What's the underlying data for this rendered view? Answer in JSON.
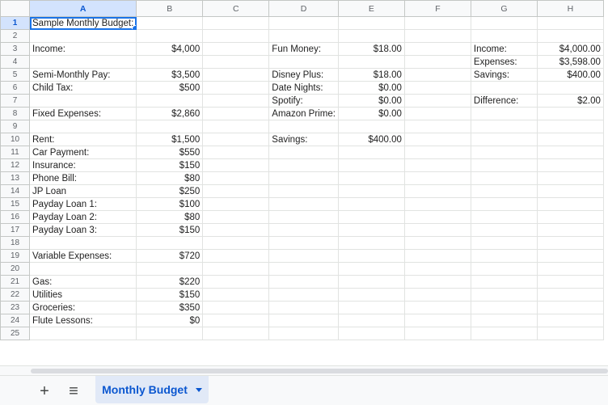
{
  "columns": [
    "A",
    "B",
    "C",
    "D",
    "E",
    "F",
    "G",
    "H"
  ],
  "active_cell": "A1",
  "rows": [
    {
      "n": "1",
      "a": "Sample Monthly Budget:",
      "b": "",
      "d": "",
      "e": "",
      "g": "",
      "h": ""
    },
    {
      "n": "2",
      "a": "",
      "b": "",
      "d": "",
      "e": "",
      "g": "",
      "h": ""
    },
    {
      "n": "3",
      "a": "Income:",
      "b": "$4,000",
      "d": "Fun Money:",
      "e": "$18.00",
      "g": "Income:",
      "h": "$4,000.00"
    },
    {
      "n": "4",
      "a": "",
      "b": "",
      "d": "",
      "e": "",
      "g": "Expenses:",
      "h": "$3,598.00"
    },
    {
      "n": "5",
      "a": "Semi-Monthly Pay:",
      "b": "$3,500",
      "d": "Disney Plus:",
      "e": "$18.00",
      "g": "Savings:",
      "h": "$400.00"
    },
    {
      "n": "6",
      "a": "Child Tax:",
      "b": "$500",
      "d": "Date Nights:",
      "e": "$0.00",
      "g": "",
      "h": ""
    },
    {
      "n": "7",
      "a": "",
      "b": "",
      "d": "Spotify:",
      "e": "$0.00",
      "g": "Difference:",
      "h": "$2.00"
    },
    {
      "n": "8",
      "a": "Fixed Expenses:",
      "b": "$2,860",
      "d": "Amazon Prime:",
      "e": "$0.00",
      "g": "",
      "h": ""
    },
    {
      "n": "9",
      "a": "",
      "b": "",
      "d": "",
      "e": "",
      "g": "",
      "h": ""
    },
    {
      "n": "10",
      "a": "Rent:",
      "b": "$1,500",
      "d": "Savings:",
      "e": "$400.00",
      "g": "",
      "h": ""
    },
    {
      "n": "11",
      "a": "Car Payment:",
      "b": "$550",
      "d": "",
      "e": "",
      "g": "",
      "h": ""
    },
    {
      "n": "12",
      "a": "Insurance:",
      "b": "$150",
      "d": "",
      "e": "",
      "g": "",
      "h": ""
    },
    {
      "n": "13",
      "a": "Phone Bill:",
      "b": "$80",
      "d": "",
      "e": "",
      "g": "",
      "h": ""
    },
    {
      "n": "14",
      "a": "JP Loan",
      "b": "$250",
      "d": "",
      "e": "",
      "g": "",
      "h": ""
    },
    {
      "n": "15",
      "a": "Payday Loan 1:",
      "b": "$100",
      "d": "",
      "e": "",
      "g": "",
      "h": ""
    },
    {
      "n": "16",
      "a": "Payday Loan 2:",
      "b": "$80",
      "d": "",
      "e": "",
      "g": "",
      "h": ""
    },
    {
      "n": "17",
      "a": "Payday Loan 3:",
      "b": "$150",
      "d": "",
      "e": "",
      "g": "",
      "h": ""
    },
    {
      "n": "18",
      "a": "",
      "b": "",
      "d": "",
      "e": "",
      "g": "",
      "h": ""
    },
    {
      "n": "19",
      "a": "Variable Expenses:",
      "b": "$720",
      "d": "",
      "e": "",
      "g": "",
      "h": ""
    },
    {
      "n": "20",
      "a": "",
      "b": "",
      "d": "",
      "e": "",
      "g": "",
      "h": ""
    },
    {
      "n": "21",
      "a": "Gas:",
      "b": "$220",
      "d": "",
      "e": "",
      "g": "",
      "h": ""
    },
    {
      "n": "22",
      "a": "Utilities",
      "b": "$150",
      "d": "",
      "e": "",
      "g": "",
      "h": ""
    },
    {
      "n": "23",
      "a": "Groceries:",
      "b": "$350",
      "d": "",
      "e": "",
      "g": "",
      "h": ""
    },
    {
      "n": "24",
      "a": "Flute Lessons:",
      "b": "$0",
      "d": "",
      "e": "",
      "g": "",
      "h": ""
    },
    {
      "n": "25",
      "a": "",
      "b": "",
      "d": "",
      "e": "",
      "g": "",
      "h": ""
    }
  ],
  "sheet_bar": {
    "add_icon": "plus-icon",
    "add_glyph": "+",
    "list_icon": "menu-icon",
    "list_glyph": "≡",
    "active_tab": "Monthly Budget"
  },
  "colors": {
    "accent": "#1a73e8",
    "selected_header": "#d3e3fd",
    "tab_bg": "#e1e9f7"
  }
}
